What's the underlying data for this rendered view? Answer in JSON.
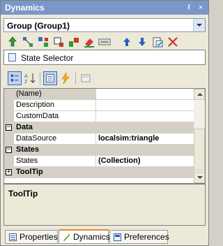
{
  "window": {
    "title": "Dynamics",
    "pin_label": "ᵮ",
    "close_label": "×"
  },
  "object_combo": {
    "value": "Group (Group1)"
  },
  "toolbar1": {
    "icons": [
      "green-arrow-icon",
      "connector-icon",
      "move-icon",
      "resize-icon",
      "color-icon",
      "fill-icon",
      "display-icon",
      "arrow-up-icon",
      "arrow-down-icon",
      "paste-icon",
      "delete-icon"
    ]
  },
  "selector": {
    "label": "State Selector"
  },
  "toolbar2": {
    "icons": [
      "categorized-icon",
      "alphabetical-icon",
      "properties-icon",
      "events-icon",
      "property-pages-icon"
    ]
  },
  "property_grid": {
    "rows": [
      {
        "type": "prop",
        "name": "(Name)",
        "value": ""
      },
      {
        "type": "prop",
        "name": "Description",
        "value": ""
      },
      {
        "type": "prop",
        "name": "CustomData",
        "value": ""
      },
      {
        "type": "cat",
        "name": "Data",
        "expander": "−"
      },
      {
        "type": "prop",
        "name": "DataSource",
        "value": "localsim:triangle"
      },
      {
        "type": "cat",
        "name": "States",
        "expander": "−"
      },
      {
        "type": "prop",
        "name": "States",
        "value": "(Collection)"
      },
      {
        "type": "cat",
        "name": "ToolTip",
        "expander": "+"
      }
    ]
  },
  "description_pane": {
    "title": "ToolTip"
  },
  "tabs": [
    {
      "label": "Properties",
      "active": false
    },
    {
      "label": "Dynamics",
      "active": true
    },
    {
      "label": "Preferences",
      "active": false
    }
  ]
}
